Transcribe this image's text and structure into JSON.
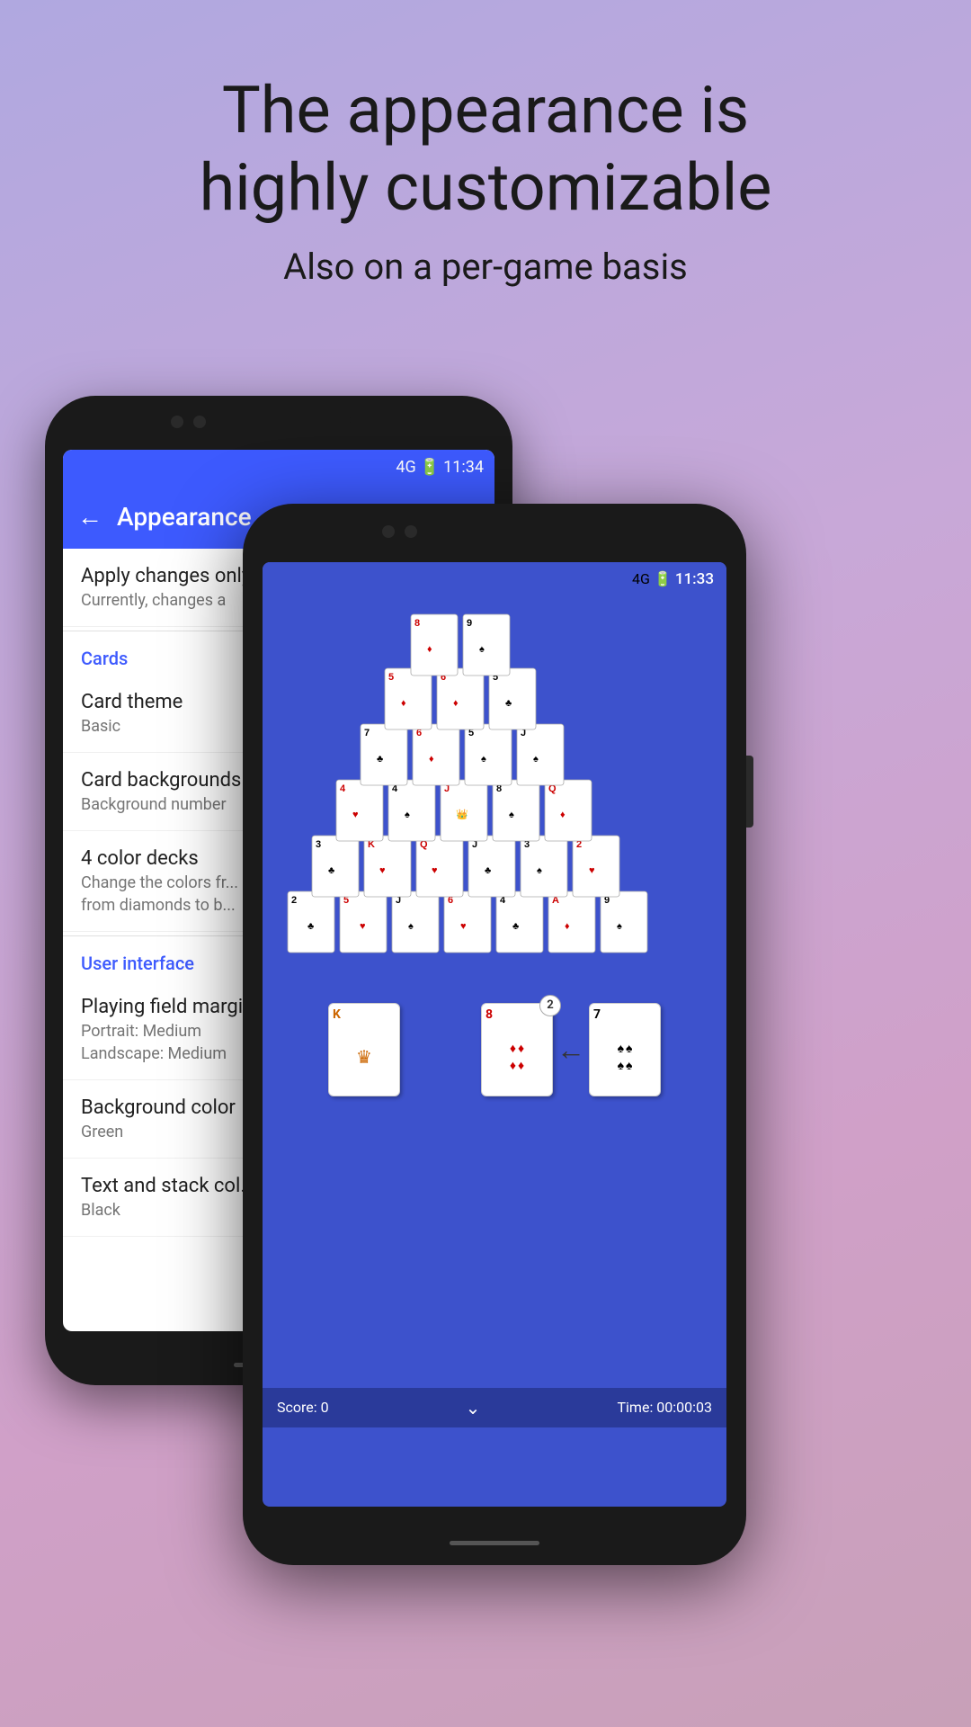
{
  "header": {
    "title_line1": "The appearance is",
    "title_line2": "highly customizable",
    "subtitle": "Also on a per-game basis"
  },
  "back_phone": {
    "status_bar": {
      "network": "4G",
      "battery": "🔋",
      "time": "11:34"
    },
    "app_bar": {
      "back_label": "←",
      "title": "Appearance"
    },
    "settings": {
      "section_apply": {
        "title": "Apply changes only",
        "subtitle": "Currently, changes a"
      },
      "section_cards_label": "Cards",
      "card_theme": {
        "title": "Card theme",
        "subtitle": "Basic"
      },
      "card_backgrounds": {
        "title": "Card backgrounds",
        "subtitle": "Background number"
      },
      "four_color_decks": {
        "title": "4 color decks",
        "subtitle": "Change the colors fr...",
        "subtitle2": "from diamonds to b..."
      },
      "section_ui_label": "User interface",
      "playing_field_margins": {
        "title": "Playing field margi...",
        "subtitle1": "Portrait: Medium",
        "subtitle2": "Landscape: Medium"
      },
      "background_color": {
        "title": "Background color",
        "subtitle": "Green"
      },
      "text_stack_color": {
        "title": "Text and stack col...",
        "subtitle": "Black"
      }
    }
  },
  "front_phone": {
    "status_bar": {
      "network": "4G",
      "battery": "🔋",
      "time": "11:33"
    },
    "game": {
      "score_label": "Score: 0",
      "time_label": "Time: 00:00:03",
      "arrow_badge": "2"
    }
  }
}
